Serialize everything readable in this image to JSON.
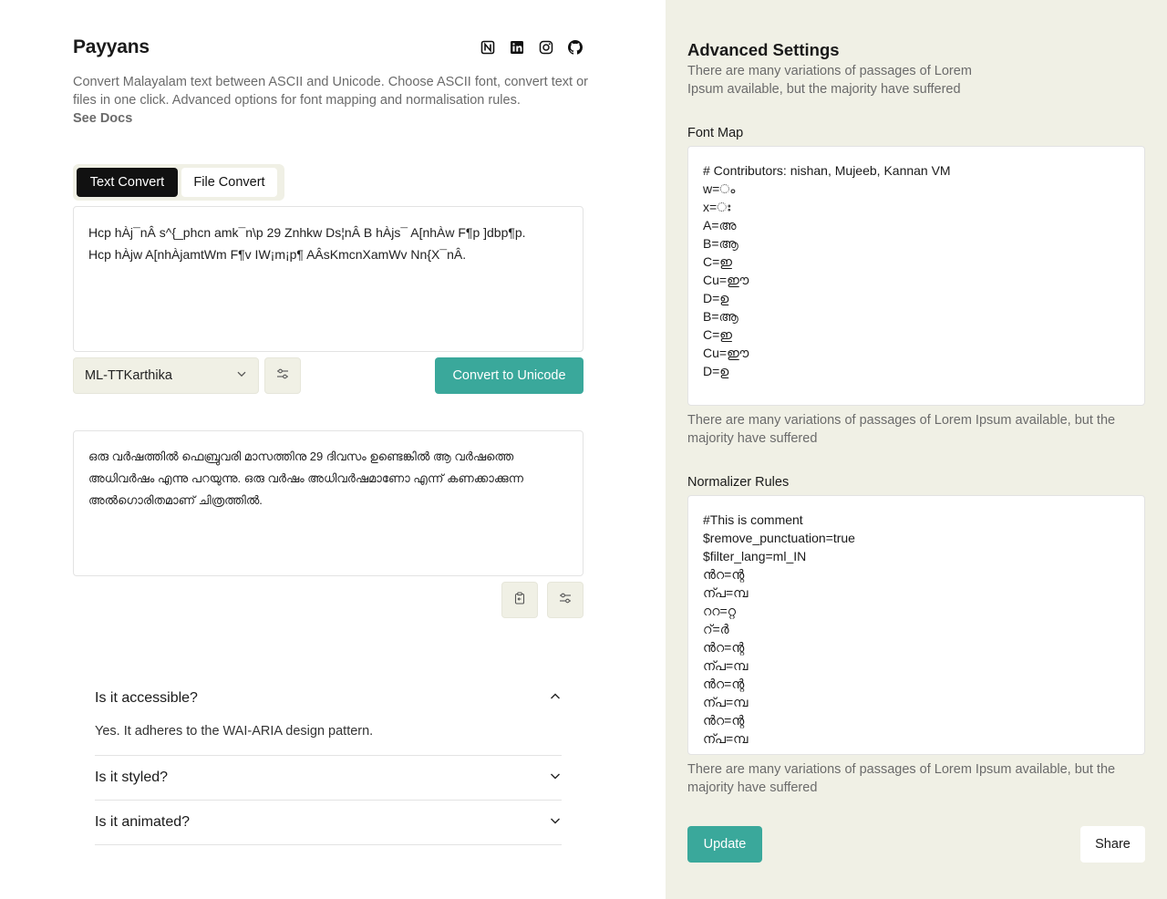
{
  "app": {
    "title": "Payyans",
    "description": "Convert Malayalam text between ASCII and Unicode. Choose ASCII font, convert text or files in one click. Advanced options for font mapping and normalisation rules.",
    "see_docs": "See Docs"
  },
  "social_icons": [
    "notion-icon",
    "linkedin-icon",
    "instagram-icon",
    "github-icon"
  ],
  "tabs": [
    {
      "label": "Text Convert",
      "active": true
    },
    {
      "label": "File Convert",
      "active": false
    }
  ],
  "input": {
    "lines": [
      "Hcp hÀj¯nÂ s^{_phcn amk¯n\\p 29 Znhkw Ds¦nÂ B hÀjs¯ A[nhÀw F¶p ]dbp¶p.",
      "Hcp hÀjw A[nhÀjamtWm F¶v IW¡m¡p¶ AÂsKmcnXamWv Nn{X¯nÂ."
    ]
  },
  "font_select": {
    "value": "ML-TTKarthika"
  },
  "convert_button": "Convert to Unicode",
  "output": {
    "lines": [
      "ഒരു വർഷത്തിൽ ഫെബ്രുവരി മാസത്തിനു 29 ദിവസം ഉണ്ടെങ്കിൽ ആ വർഷത്തെ",
      "അധിവർഷം എന്നു പറയുന്നു. ഒരു വർഷം അധിവർഷമാണോ എന്ന് കണക്കാക്കുന്ന",
      "അൽഗൊരിതമാണ് ചിത്രത്തിൽ."
    ]
  },
  "faq": [
    {
      "question": "Is it accessible?",
      "answer": "Yes. It adheres to the WAI-ARIA design pattern.",
      "open": true
    },
    {
      "question": "Is it styled?",
      "answer": "",
      "open": false
    },
    {
      "question": "Is it animated?",
      "answer": "",
      "open": false
    }
  ],
  "advanced": {
    "title": "Advanced Settings",
    "description": "There are many variations of passages of Lorem Ipsum available, but the majority have suffered",
    "font_map": {
      "label": "Font Map",
      "lines": [
        "# Contributors: nishan, Mujeeb, Kannan VM",
        "w=ം",
        "x=ഃ",
        "A=അ",
        "B=ആ",
        "C=ഇ",
        "Cu=ഈ",
        "D=ഉ",
        "B=ആ",
        "C=ഇ",
        "Cu=ഈ",
        "D=ഉ"
      ],
      "help": "There are many variations of passages of Lorem Ipsum available, but the majority have suffered"
    },
    "normalizer": {
      "label": "Normalizer Rules",
      "lines": [
        "#This is comment",
        "$remove_punctuation=true",
        "$filter_lang=ml_IN",
        "ൻറ=ന്റ",
        "ന്പ=മ്പ",
        "ററ=റ്റ",
        "റ്=ർ",
        "ൻറ=ന്റ",
        "ന്പ=മ്പ",
        "ൻറ=ന്റ",
        "ന്പ=മ്പ",
        "ൻറ=ന്റ",
        "ന്പ=മ്പ"
      ],
      "help": "There are many variations of passages of Lorem Ipsum available, but the majority have suffered"
    },
    "update_button": "Update",
    "share_button": "Share"
  },
  "colors": {
    "accent": "#3aa89b",
    "panel_bg": "#f0f0e5",
    "dark": "#111111"
  }
}
